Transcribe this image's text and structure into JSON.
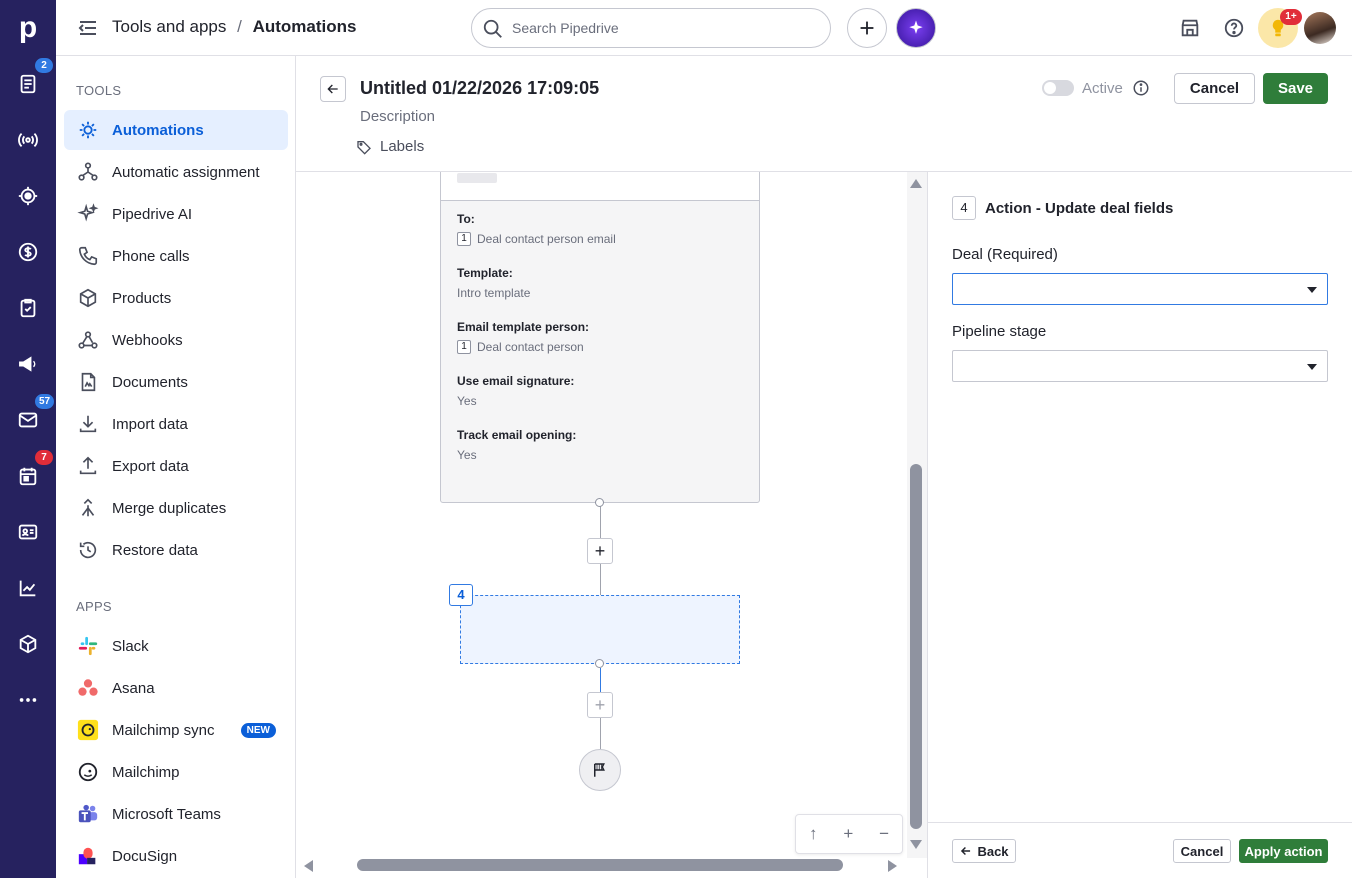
{
  "rail": {
    "logo": "p",
    "badges": {
      "activities": "2",
      "mail": "57",
      "calendar": "7"
    },
    "icons": [
      "activities-icon",
      "broadcast-icon",
      "target-icon",
      "dollar-icon",
      "tasks-icon",
      "megaphone-icon",
      "mail-icon",
      "calendar-icon",
      "contacts-icon",
      "insights-icon",
      "products-icon",
      "more-icon"
    ]
  },
  "topbar": {
    "breadcrumb_parent": "Tools and apps",
    "breadcrumb_sep": "/",
    "breadcrumb_current": "Automations",
    "search_placeholder": "Search Pipedrive",
    "notification_badge": "1+"
  },
  "sidebar": {
    "tools_title": "TOOLS",
    "tools": [
      {
        "label": "Automations",
        "icon": "automations-icon",
        "active": true
      },
      {
        "label": "Automatic assignment",
        "icon": "assignment-icon"
      },
      {
        "label": "Pipedrive AI",
        "icon": "sparkle-icon"
      },
      {
        "label": "Phone calls",
        "icon": "phone-icon"
      },
      {
        "label": "Products",
        "icon": "box-icon"
      },
      {
        "label": "Webhooks",
        "icon": "webhook-icon"
      },
      {
        "label": "Documents",
        "icon": "document-icon"
      },
      {
        "label": "Import data",
        "icon": "import-icon"
      },
      {
        "label": "Export data",
        "icon": "export-icon"
      },
      {
        "label": "Merge duplicates",
        "icon": "merge-icon"
      },
      {
        "label": "Restore data",
        "icon": "restore-icon"
      }
    ],
    "apps_title": "APPS",
    "apps": [
      {
        "label": "Slack",
        "icon": "slack-icon"
      },
      {
        "label": "Asana",
        "icon": "asana-icon"
      },
      {
        "label": "Mailchimp sync",
        "icon": "mailchimp-icon",
        "badge": "NEW"
      },
      {
        "label": "Mailchimp",
        "icon": "mailchimp-icon"
      },
      {
        "label": "Microsoft Teams",
        "icon": "teams-icon"
      },
      {
        "label": "DocuSign",
        "icon": "docusign-icon"
      }
    ]
  },
  "automation": {
    "title": "Untitled 01/22/2026 17:09:05",
    "description_placeholder": "Description",
    "labels_text": "Labels",
    "active_label": "Active",
    "active_on": false,
    "cancel_label": "Cancel",
    "save_label": "Save"
  },
  "canvas": {
    "card_fields": [
      {
        "label": "To:",
        "chip": "1",
        "value": "Deal contact person email"
      },
      {
        "label": "Template:",
        "chip": "",
        "value": "Intro template"
      },
      {
        "label": "Email template person:",
        "chip": "1",
        "value": "Deal contact person"
      },
      {
        "label": "Use email signature:",
        "chip": "",
        "value": "Yes"
      },
      {
        "label": "Track email opening:",
        "chip": "",
        "value": "Yes"
      }
    ],
    "add_step_symbol": "+",
    "new_step_number": "4",
    "zoom": {
      "up": "↑",
      "in": "+",
      "out": "−"
    }
  },
  "panel": {
    "step_number": "4",
    "title": "Action - Update deal fields",
    "deal_label": "Deal (Required)",
    "deal_value": "",
    "stage_label": "Pipeline stage",
    "stage_value": "",
    "back_label": "Back",
    "cancel_label": "Cancel",
    "apply_label": "Apply action"
  },
  "colors": {
    "rail": "#26225f",
    "accent": "#0b5fd8",
    "save_green": "#2f7d3a",
    "badge_blue": "#317ae2",
    "badge_red": "#e12d39"
  }
}
